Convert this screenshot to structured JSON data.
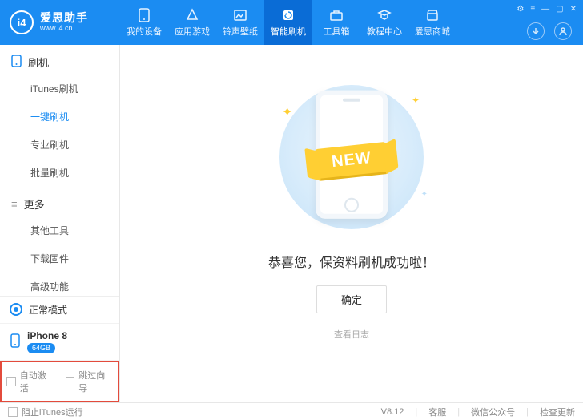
{
  "brand": {
    "name": "爱思助手",
    "logo_text": "i4",
    "url": "www.i4.cn"
  },
  "nav": {
    "items": [
      {
        "label": "我的设备"
      },
      {
        "label": "应用游戏"
      },
      {
        "label": "铃声壁纸"
      },
      {
        "label": "智能刷机"
      },
      {
        "label": "工具箱"
      },
      {
        "label": "教程中心"
      },
      {
        "label": "爱思商城"
      }
    ],
    "active_index": 3
  },
  "header_icons": {
    "download": "↓",
    "user": "◯"
  },
  "sidebar": {
    "groups": [
      {
        "title": "刷机",
        "items": [
          "iTunes刷机",
          "一键刷机",
          "专业刷机",
          "批量刷机"
        ],
        "active_index": 1
      },
      {
        "title": "更多",
        "items": [
          "其他工具",
          "下载固件",
          "高级功能"
        ],
        "active_index": -1
      }
    ],
    "mode": "正常模式",
    "device": {
      "name": "iPhone 8",
      "storage": "64GB"
    },
    "options": {
      "auto_activate": "自动激活",
      "skip_wizard": "跳过向导"
    }
  },
  "main": {
    "ribbon": "NEW",
    "message": "恭喜您，保资料刷机成功啦！",
    "ok": "确定",
    "view_log": "查看日志"
  },
  "statusbar": {
    "block_itunes": "阻止iTunes运行",
    "version": "V8.12",
    "support": "客服",
    "wechat": "微信公众号",
    "check_update": "检查更新"
  }
}
